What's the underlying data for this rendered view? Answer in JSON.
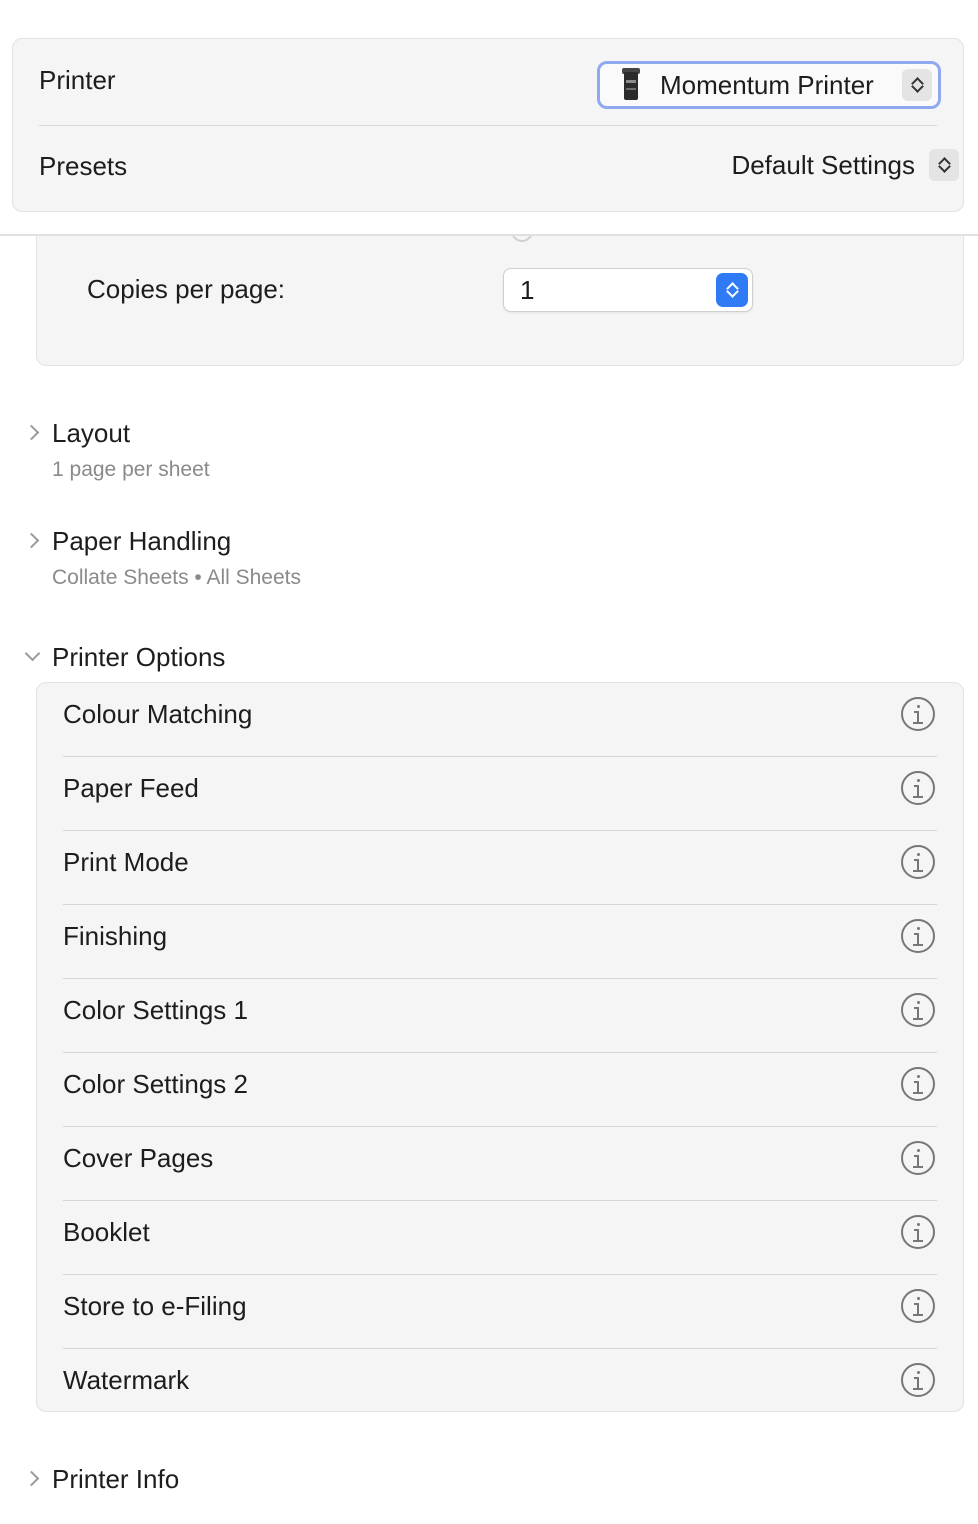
{
  "printer": {
    "label": "Printer",
    "selected": "Momentum Printer"
  },
  "presets": {
    "label": "Presets",
    "selected": "Default Settings"
  },
  "copies": {
    "label": "Copies per page:",
    "value": "1"
  },
  "layout": {
    "title": "Layout",
    "summary": "1 page per sheet"
  },
  "paper_handling": {
    "title": "Paper Handling",
    "summary": "Collate Sheets • All Sheets"
  },
  "printer_options": {
    "title": "Printer Options",
    "items": [
      {
        "label": "Colour Matching"
      },
      {
        "label": "Paper Feed"
      },
      {
        "label": "Print Mode"
      },
      {
        "label": "Finishing"
      },
      {
        "label": "Color Settings 1"
      },
      {
        "label": "Color Settings 2"
      },
      {
        "label": "Cover Pages"
      },
      {
        "label": "Booklet"
      },
      {
        "label": "Store to e-Filing"
      },
      {
        "label": "Watermark"
      }
    ]
  },
  "printer_info": {
    "title": "Printer Info"
  },
  "colors": {
    "accent": "#2f7bf5",
    "focus_ring": "#8fa9f0",
    "panel": "#f5f5f5"
  }
}
